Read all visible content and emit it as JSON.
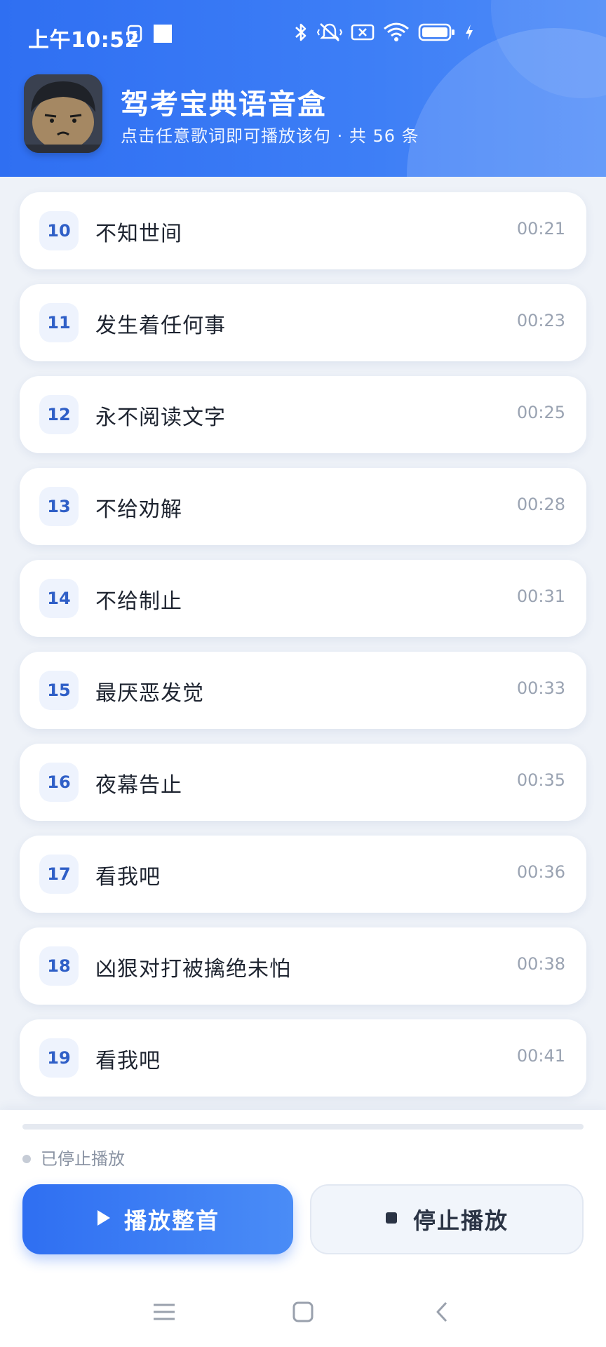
{
  "status_bar": {
    "time": "上午10:52",
    "icons": [
      "sim-icon",
      "notification-square-icon",
      "bluetooth-icon",
      "mute-vibrate-icon",
      "no-sim-icon",
      "wifi-icon",
      "battery-icon",
      "charging-icon"
    ]
  },
  "header": {
    "title": "驾考宝典语音盒",
    "subtitle": "点击任意歌词即可播放该句 · 共 56 条",
    "avatar": "cartoon-face-avatar"
  },
  "lyrics": [
    {
      "num": "10",
      "text": "不知世间",
      "time": "00:21"
    },
    {
      "num": "11",
      "text": "发生着任何事",
      "time": "00:23"
    },
    {
      "num": "12",
      "text": "永不阅读文字",
      "time": "00:25"
    },
    {
      "num": "13",
      "text": "不给劝解",
      "time": "00:28"
    },
    {
      "num": "14",
      "text": "不给制止",
      "time": "00:31"
    },
    {
      "num": "15",
      "text": "最厌恶发觉",
      "time": "00:33"
    },
    {
      "num": "16",
      "text": "夜幕告止",
      "time": "00:35"
    },
    {
      "num": "17",
      "text": "看我吧",
      "time": "00:36"
    },
    {
      "num": "18",
      "text": "凶狠对打被擒绝未怕",
      "time": "00:38"
    },
    {
      "num": "19",
      "text": "看我吧",
      "time": "00:41"
    }
  ],
  "player": {
    "progress": 0,
    "status": "已停止播放",
    "play_label": "播放整首",
    "stop_label": "停止播放",
    "colors": {
      "accent": "#2f6ff2",
      "accent_light": "#4a8cf6"
    }
  },
  "navbar": {
    "icons": [
      "menu-icon",
      "home-icon",
      "back-icon"
    ]
  }
}
